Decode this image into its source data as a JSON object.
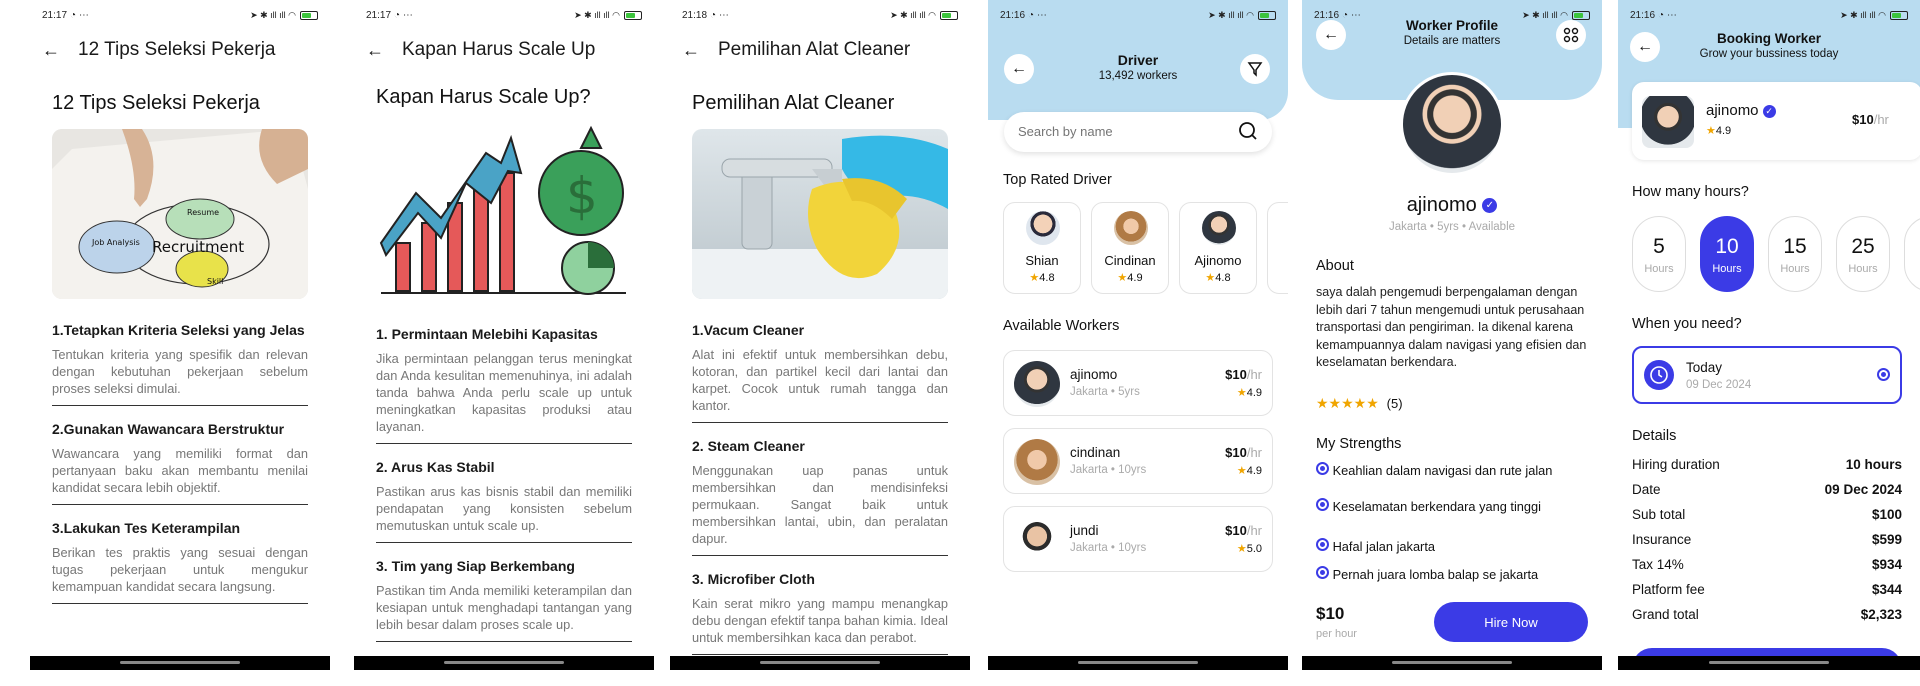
{
  "screens": [
    {
      "time": "21:17",
      "header": "12 Tips Seleksi Pekerja",
      "title": "12 Tips Seleksi Pekerja",
      "image_labels": {
        "a": "Recruitment",
        "b": "Job Analysis",
        "c": "Resume",
        "d": "Skill"
      },
      "sections": [
        {
          "h": "1.Tetapkan Kriteria Seleksi yang Jelas",
          "p": "Tentukan kriteria yang spesifik dan relevan dengan kebutuhan pekerjaan sebelum proses seleksi dimulai."
        },
        {
          "h": "2.Gunakan Wawancara Berstruktur",
          "p": "Wawancara yang memiliki format dan pertanyaan baku akan membantu menilai kandidat secara lebih objektif."
        },
        {
          "h": "3.Lakukan Tes Keterampilan",
          "p": "Berikan tes praktis yang sesuai dengan tugas pekerjaan untuk mengukur kemampuan kandidat secara langsung."
        }
      ]
    },
    {
      "time": "21:17",
      "header": "Kapan Harus Scale Up",
      "title": "Kapan Harus Scale Up?",
      "sections": [
        {
          "h": "1. Permintaan Melebihi Kapasitas",
          "p": "Jika permintaan pelanggan terus meningkat dan Anda kesulitan memenuhinya, ini adalah tanda bahwa Anda perlu scale up untuk meningkatkan kapasitas produksi atau layanan."
        },
        {
          "h": "2. Arus Kas Stabil",
          "p": "Pastikan arus kas bisnis stabil dan memiliki pendapatan yang konsisten sebelum memutuskan untuk scale up."
        },
        {
          "h": "3. Tim yang Siap Berkembang",
          "p": "Pastikan tim Anda memiliki keterampilan dan kesiapan untuk menghadapi tantangan yang lebih besar dalam proses scale up."
        }
      ]
    },
    {
      "time": "21:18",
      "header": "Pemilihan Alat Cleaner",
      "title": "Pemilihan Alat Cleaner",
      "sections": [
        {
          "h": "1.Vacum Cleaner",
          "p": "Alat ini efektif untuk membersihkan debu, kotoran, dan partikel kecil dari lantai dan karpet. Cocok untuk rumah tangga dan kantor."
        },
        {
          "h": "2. Steam Cleaner",
          "p": "Menggunakan uap panas untuk membersihkan dan mendisinfeksi permukaan. Sangat baik untuk membersihkan lantai, ubin, dan peralatan dapur."
        },
        {
          "h": "3. Microfiber Cloth",
          "p": "Kain serat mikro yang mampu menangkap debu dengan efektif tanpa bahan kimia. Ideal untuk membersihkan kaca dan perabot."
        }
      ]
    }
  ],
  "driver": {
    "time": "21:16",
    "title": "Driver",
    "subtitle": "13,492 workers",
    "search_placeholder": "Search by name",
    "top_rated_label": "Top Rated Driver",
    "top_rated": [
      {
        "name": "Shian",
        "rating": "4.8"
      },
      {
        "name": "Cindinan",
        "rating": "4.9"
      },
      {
        "name": "Ajinomo",
        "rating": "4.8"
      }
    ],
    "available_label": "Available Workers",
    "workers": [
      {
        "name": "ajinomo",
        "meta": "Jakarta • 5yrs",
        "price": "$10",
        "unit": "/hr",
        "rating": "4.9"
      },
      {
        "name": "cindinan",
        "meta": "Jakarta • 10yrs",
        "price": "$10",
        "unit": "/hr",
        "rating": "4.9"
      },
      {
        "name": "jundi",
        "meta": "Jakarta • 10yrs",
        "price": "$10",
        "unit": "/hr",
        "rating": "5.0"
      }
    ]
  },
  "profile": {
    "time": "21:16",
    "title": "Worker Profile",
    "subtitle": "Details are matters",
    "name": "ajinomo",
    "meta": "Jakarta • 5yrs • Available",
    "about_label": "About",
    "about": "saya dalah pengemudi berpengalaman dengan lebih dari 7 tahun mengemudi untuk perusahaan transportasi dan pengiriman. Ia dikenal karena kemampuannya dalam navigasi yang efisien dan keselamatan berkendara.",
    "stars": "★★★★★",
    "reviews": "(5)",
    "strengths_label": "My Strengths",
    "strengths": [
      "Keahlian dalam navigasi dan rute jalan",
      "Keselamatan berkendara yang tinggi",
      "Hafal jalan jakarta",
      "Pernah juara lomba balap se jakarta"
    ],
    "price": "$10",
    "per": "per hour",
    "hire": "Hire Now"
  },
  "booking": {
    "time": "21:16",
    "title": "Booking Worker",
    "subtitle": "Grow your bussiness today",
    "name": "ajinomo",
    "rating": "4.9",
    "price": "$10",
    "unit": "/hr",
    "hours_label": "How many hours?",
    "hours": [
      {
        "n": "5",
        "l": "Hours"
      },
      {
        "n": "10",
        "l": "Hours"
      },
      {
        "n": "15",
        "l": "Hours"
      },
      {
        "n": "25",
        "l": "Hours"
      }
    ],
    "when_label": "When you need?",
    "when_title": "Today",
    "when_date": "09 Dec 2024",
    "details_label": "Details",
    "details": [
      {
        "k": "Hiring duration",
        "v": "10 hours"
      },
      {
        "k": "Date",
        "v": "09 Dec 2024"
      },
      {
        "k": "Sub total",
        "v": "$100"
      },
      {
        "k": "Insurance",
        "v": "$599"
      },
      {
        "k": "Tax 14%",
        "v": "$934"
      },
      {
        "k": "Platform fee",
        "v": "$344"
      },
      {
        "k": "Grand total",
        "v": "$2,323"
      }
    ]
  },
  "colors": {
    "accent": "#3b3be6",
    "header_blue": "#b9dcf0",
    "star": "#f0a500"
  },
  "icons": [
    "back-arrow-icon",
    "filter-icon",
    "search-icon",
    "star-icon",
    "verified-icon",
    "clock-icon",
    "grid-icon"
  ]
}
